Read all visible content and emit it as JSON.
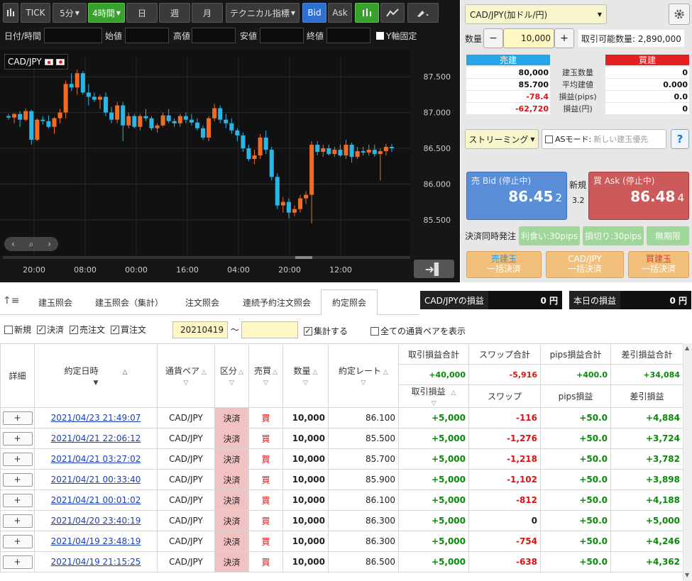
{
  "toolbar": {
    "tick": "TICK",
    "m5": "5分",
    "h4": "4時間",
    "day": "日",
    "week": "週",
    "month": "月",
    "tech": "テクニカル指標",
    "bid": "Bid",
    "ask": "Ask"
  },
  "ohlc": {
    "datetime": "日付/時間",
    "open": "始値",
    "high": "高値",
    "low": "安値",
    "close": "終値",
    "yfix": "Y軸固定"
  },
  "chart_data": {
    "type": "candlestick",
    "pair": "CAD/JPY",
    "y_ticks": [
      "87.500",
      "87.000",
      "86.500",
      "86.000",
      "85.500"
    ],
    "x_ticks": [
      "20:00",
      "08:00",
      "00:00",
      "16:00",
      "04:00",
      "20:00",
      "12:00"
    ],
    "ylim": [
      85.3,
      87.8
    ],
    "candles": [
      [
        86.95,
        86.98,
        86.9,
        86.93
      ],
      [
        86.93,
        86.99,
        86.85,
        86.98
      ],
      [
        86.98,
        87.02,
        86.8,
        86.9
      ],
      [
        86.9,
        87.06,
        86.88,
        87.02
      ],
      [
        87.02,
        87.04,
        86.55,
        86.62
      ],
      [
        86.62,
        86.92,
        86.6,
        86.9
      ],
      [
        86.9,
        86.95,
        86.83,
        86.88
      ],
      [
        86.88,
        86.96,
        86.78,
        86.8
      ],
      [
        86.8,
        86.94,
        86.7,
        86.92
      ],
      [
        86.92,
        87.05,
        86.85,
        87.0
      ],
      [
        87.0,
        87.45,
        86.92,
        87.4
      ],
      [
        87.4,
        87.55,
        87.3,
        87.35
      ],
      [
        87.35,
        87.6,
        87.25,
        87.55
      ],
      [
        87.55,
        87.58,
        87.25,
        87.28
      ],
      [
        87.28,
        87.4,
        87.1,
        87.22
      ],
      [
        87.22,
        87.28,
        87.15,
        87.18
      ],
      [
        87.18,
        87.25,
        87.05,
        87.22
      ],
      [
        87.22,
        87.28,
        86.95,
        87.0
      ],
      [
        87.0,
        87.08,
        86.85,
        86.9
      ],
      [
        86.9,
        87.15,
        86.85,
        87.1
      ],
      [
        87.1,
        87.15,
        86.6,
        86.82
      ],
      [
        86.82,
        87.0,
        86.78,
        86.95
      ],
      [
        86.95,
        86.98,
        86.78,
        86.8
      ],
      [
        86.8,
        86.98,
        86.75,
        86.95
      ],
      [
        86.95,
        87.05,
        86.88,
        86.92
      ],
      [
        86.92,
        86.95,
        86.75,
        86.78
      ],
      [
        86.78,
        86.85,
        86.72,
        86.82
      ],
      [
        86.82,
        87.0,
        86.8,
        86.96
      ],
      [
        86.96,
        87.05,
        86.85,
        86.88
      ],
      [
        86.88,
        86.92,
        86.8,
        86.85
      ],
      [
        86.85,
        86.98,
        86.8,
        86.95
      ],
      [
        86.95,
        87.0,
        86.85,
        86.9
      ],
      [
        86.9,
        86.98,
        86.82,
        86.86
      ],
      [
        86.86,
        86.92,
        86.75,
        86.78
      ],
      [
        86.78,
        86.82,
        86.62,
        86.65
      ],
      [
        86.65,
        86.95,
        86.6,
        86.92
      ],
      [
        86.92,
        87.12,
        86.88,
        87.06
      ],
      [
        87.06,
        87.1,
        86.85,
        86.9
      ],
      [
        86.9,
        86.98,
        86.78,
        86.85
      ],
      [
        86.85,
        86.92,
        86.7,
        86.75
      ],
      [
        86.75,
        86.78,
        86.6,
        86.68
      ],
      [
        86.68,
        86.72,
        86.45,
        86.5
      ],
      [
        86.5,
        86.55,
        86.32,
        86.35
      ],
      [
        86.35,
        86.48,
        86.28,
        86.4
      ],
      [
        86.4,
        86.7,
        86.35,
        86.65
      ],
      [
        86.65,
        86.75,
        86.42,
        86.48
      ],
      [
        86.48,
        86.52,
        86.05,
        86.1
      ],
      [
        86.1,
        86.15,
        85.65,
        85.7
      ],
      [
        85.7,
        85.82,
        85.6,
        85.75
      ],
      [
        85.75,
        85.8,
        85.52,
        85.6
      ],
      [
        85.6,
        85.7,
        85.55,
        85.65
      ],
      [
        85.65,
        85.85,
        85.6,
        85.8
      ],
      [
        85.8,
        85.9,
        85.72,
        85.85
      ],
      [
        85.85,
        86.6,
        85.45,
        86.55
      ],
      [
        86.55,
        86.6,
        86.4,
        86.45
      ],
      [
        86.45,
        86.55,
        86.38,
        86.5
      ],
      [
        86.5,
        86.55,
        86.4,
        86.42
      ],
      [
        86.42,
        86.52,
        86.38,
        86.48
      ],
      [
        86.48,
        86.55,
        86.38,
        86.4
      ],
      [
        86.4,
        86.62,
        86.35,
        86.55
      ],
      [
        86.55,
        86.58,
        86.3,
        86.38
      ],
      [
        86.38,
        86.52,
        86.35,
        86.46
      ],
      [
        86.46,
        86.52,
        86.4,
        86.44
      ],
      [
        86.44,
        86.55,
        86.4,
        86.48
      ],
      [
        86.48,
        86.55,
        86.38,
        86.42
      ],
      [
        86.42,
        86.5,
        86.05,
        86.46
      ],
      [
        86.46,
        86.56,
        86.4,
        86.52
      ],
      [
        86.52,
        86.56,
        86.45,
        86.5
      ]
    ]
  },
  "order": {
    "pair_select": "CAD/JPY(加ドル/円)",
    "qty_label": "数量",
    "qty_value": "10,000",
    "available": "取引可能数量: 2,890,000",
    "sell_header": "売建",
    "buy_header": "買建",
    "rows": [
      {
        "label": "建玉数量",
        "sell": "80,000",
        "buy": "0",
        "neg": false
      },
      {
        "label": "平均建値",
        "sell": "85.700",
        "buy": "0.000",
        "neg": false
      },
      {
        "label": "損益(pips)",
        "sell": "-78.4",
        "buy": "0.0",
        "neg": true
      },
      {
        "label": "損益(円)",
        "sell": "-62,720",
        "buy": "0",
        "neg": true
      }
    ],
    "streaming": "ストリーミング",
    "as_mode": "ASモード:",
    "as_placeholder": "新しい建玉優先",
    "bid_label": "売 Bid (停止中)",
    "bid_big": "86.45",
    "bid_small": "2",
    "ask_label": "買 Ask (停止中)",
    "ask_big": "86.48",
    "ask_small": "4",
    "new_label": "新規",
    "spread": "3.2",
    "settle_label": "決済同時発注",
    "take_profit": "利食い:30pips",
    "stop_loss": "損切り:30pips",
    "unlimited": "無期限",
    "btn_sell_close_1": "売建玉",
    "btn_sell_close_2": "一括決済",
    "btn_pair_close_1": "CAD/JPY",
    "btn_pair_close_2": "一括決済",
    "btn_buy_close_1": "買建玉",
    "btn_buy_close_2": "一括決済"
  },
  "tabs": [
    "建玉照会",
    "建玉照会（集計）",
    "注文照会",
    "連続予約注文照会",
    "約定照会"
  ],
  "pnl": {
    "pair_label": "CAD/JPYの損益",
    "pair_value": "0 円",
    "today_label": "本日の損益",
    "today_value": "0 円"
  },
  "filters": {
    "new": "新規",
    "settle": "決済",
    "sell": "売注文",
    "buy": "買注文",
    "date_from": "20210419",
    "tilde": "～",
    "aggregate": "集計する",
    "all_pairs": "全ての通貨ペアを表示"
  },
  "table": {
    "headers": {
      "detail": "詳細",
      "date": "約定日時",
      "pair": "通貨ペア",
      "kind": "区分",
      "side": "売買",
      "qty": "数量",
      "rate": "約定レート",
      "pl_total": "取引損益合計",
      "swap_total": "スワップ合計",
      "pips_total": "pips損益合計",
      "net_total": "差引損益合計",
      "pl": "取引損益",
      "swap": "スワップ",
      "pips": "pips損益",
      "net": "差引損益"
    },
    "totals": {
      "pl": "+40,000",
      "swap": "-5,916",
      "pips": "+400.0",
      "net": "+34,084"
    },
    "rows": [
      {
        "date": "2021/04/23 21:49:07",
        "pair": "CAD/JPY",
        "kind": "決済",
        "side": "買",
        "qty": "10,000",
        "rate": "86.100",
        "pl": "+5,000",
        "swap": "-116",
        "pips": "+50.0",
        "net": "+4,884"
      },
      {
        "date": "2021/04/21 22:06:12",
        "pair": "CAD/JPY",
        "kind": "決済",
        "side": "買",
        "qty": "10,000",
        "rate": "85.500",
        "pl": "+5,000",
        "swap": "-1,276",
        "pips": "+50.0",
        "net": "+3,724"
      },
      {
        "date": "2021/04/21 03:27:02",
        "pair": "CAD/JPY",
        "kind": "決済",
        "side": "買",
        "qty": "10,000",
        "rate": "85.700",
        "pl": "+5,000",
        "swap": "-1,218",
        "pips": "+50.0",
        "net": "+3,782"
      },
      {
        "date": "2021/04/21 00:33:40",
        "pair": "CAD/JPY",
        "kind": "決済",
        "side": "買",
        "qty": "10,000",
        "rate": "85.900",
        "pl": "+5,000",
        "swap": "-1,102",
        "pips": "+50.0",
        "net": "+3,898"
      },
      {
        "date": "2021/04/21 00:01:02",
        "pair": "CAD/JPY",
        "kind": "決済",
        "side": "買",
        "qty": "10,000",
        "rate": "86.100",
        "pl": "+5,000",
        "swap": "-812",
        "pips": "+50.0",
        "net": "+4,188"
      },
      {
        "date": "2021/04/20 23:40:19",
        "pair": "CAD/JPY",
        "kind": "決済",
        "side": "買",
        "qty": "10,000",
        "rate": "86.300",
        "pl": "+5,000",
        "swap": "0",
        "pips": "+50.0",
        "net": "+5,000"
      },
      {
        "date": "2021/04/19 23:48:19",
        "pair": "CAD/JPY",
        "kind": "決済",
        "side": "買",
        "qty": "10,000",
        "rate": "86.300",
        "pl": "+5,000",
        "swap": "-754",
        "pips": "+50.0",
        "net": "+4,246"
      },
      {
        "date": "2021/04/19 21:15:25",
        "pair": "CAD/JPY",
        "kind": "決済",
        "side": "買",
        "qty": "10,000",
        "rate": "86.500",
        "pl": "+5,000",
        "swap": "-638",
        "pips": "+50.0",
        "net": "+4,362"
      }
    ]
  },
  "colors": {
    "up": "#f26b22",
    "down": "#29b6e6",
    "accent_green": "#38a02c",
    "bid_blue": "#5a8ed8",
    "ask_red": "#cc5a5a"
  }
}
